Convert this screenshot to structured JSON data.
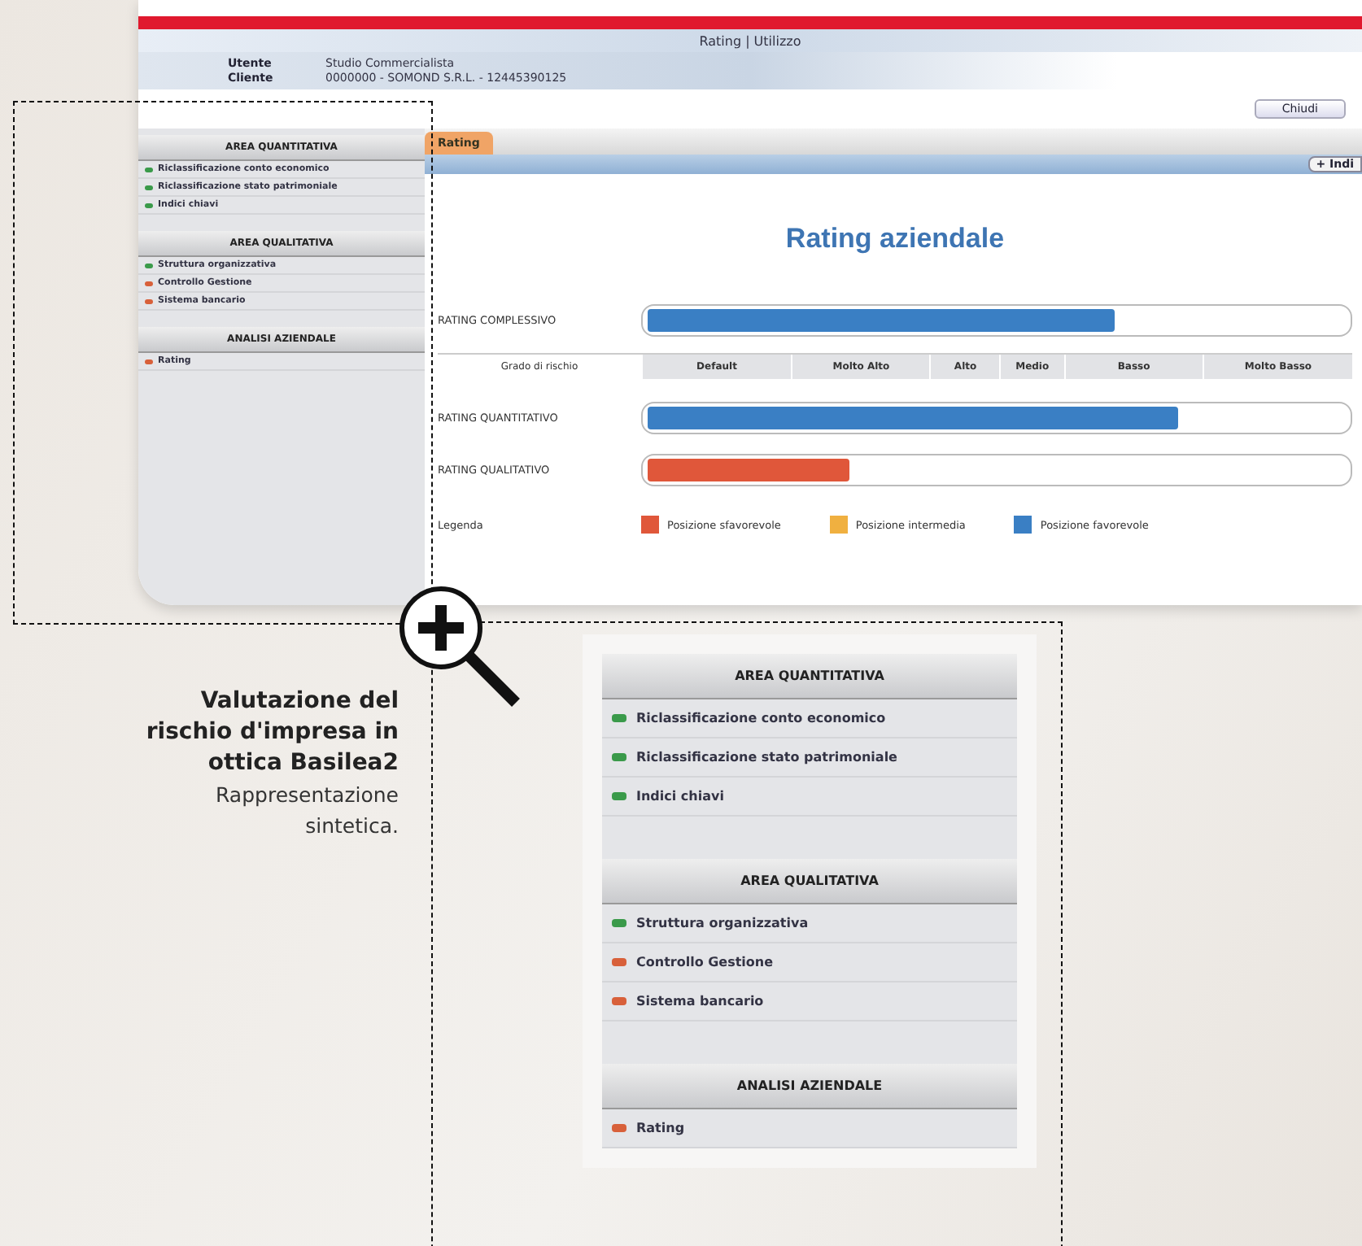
{
  "screen": {
    "title": "Rating | Utilizzo",
    "header": [
      {
        "label": "Utente",
        "value": "Studio Commercialista"
      },
      {
        "label": "Cliente",
        "value": "0000000 - SOMOND S.R.L. - 12445390125"
      }
    ],
    "toolbar_button": "Chiudi",
    "tabs": [
      {
        "label": "Rating",
        "selected": true
      }
    ],
    "strip_button": "+ Indi",
    "sidebar": [
      {
        "title": "AREA QUANTITATIVA",
        "items": [
          {
            "label": "Riclassificazione conto economico",
            "color": "#3a9a4a"
          },
          {
            "label": "Riclassificazione stato patrimoniale",
            "color": "#3a9a4a"
          },
          {
            "label": "Indici chiavi",
            "color": "#3a9a4a"
          }
        ]
      },
      {
        "title": "AREA QUALITATIVA",
        "items": [
          {
            "label": "Struttura organizzativa",
            "color": "#3a9a4a"
          },
          {
            "label": "Controllo Gestione",
            "color": "#d8603a"
          },
          {
            "label": "Sistema bancario",
            "color": "#d8603a"
          }
        ]
      },
      {
        "title": "ANALISI AZIENDALE",
        "items": [
          {
            "label": "Rating",
            "color": "#d8603a"
          }
        ]
      }
    ],
    "heading": "Rating aziendale",
    "overall": {
      "label": "RATING COMPLESSIVO",
      "level": 0.67,
      "color": "#3a7fc4"
    },
    "grades": {
      "label": "Grado di rischio",
      "columns": [
        "Default",
        "Molto Alto",
        "Alto",
        "Medio",
        "Basso",
        "Molto Basso"
      ]
    },
    "ratings": [
      {
        "label": "RATING QUANTITATIVO",
        "level": 0.76,
        "color": "#3a7fc4"
      },
      {
        "label": "RATING QUALITATIVO",
        "level": 0.29,
        "color": "#e0573a"
      }
    ],
    "legend": {
      "label": "Legenda",
      "items": [
        {
          "label": "Posizione sfavorevole",
          "color": "#e0573a"
        },
        {
          "label": "Posizione intermedia",
          "color": "#f0b040"
        },
        {
          "label": "Posizione favorevole",
          "color": "#3a7fc4"
        }
      ]
    }
  },
  "caption": {
    "title": "Valutazione del rischio d'impresa in ottica Basilea2",
    "text": "Rappresentazione sintetica."
  },
  "zoomed_sidebar": [
    {
      "title": "AREA QUANTITATIVA",
      "items": [
        {
          "label": "Riclassificazione conto economico",
          "color": "#3a9a4a"
        },
        {
          "label": "Riclassificazione stato patrimoniale",
          "color": "#3a9a4a"
        },
        {
          "label": "Indici chiavi",
          "color": "#3a9a4a"
        }
      ]
    },
    {
      "title": "AREA QUALITATIVA",
      "items": [
        {
          "label": "Struttura organizzativa",
          "color": "#3a9a4a"
        },
        {
          "label": "Controllo Gestione",
          "color": "#d8603a"
        },
        {
          "label": "Sistema bancario",
          "color": "#d8603a"
        }
      ]
    },
    {
      "title": "ANALISI AZIENDALE",
      "items": [
        {
          "label": "Rating",
          "color": "#d8603a"
        }
      ]
    }
  ]
}
